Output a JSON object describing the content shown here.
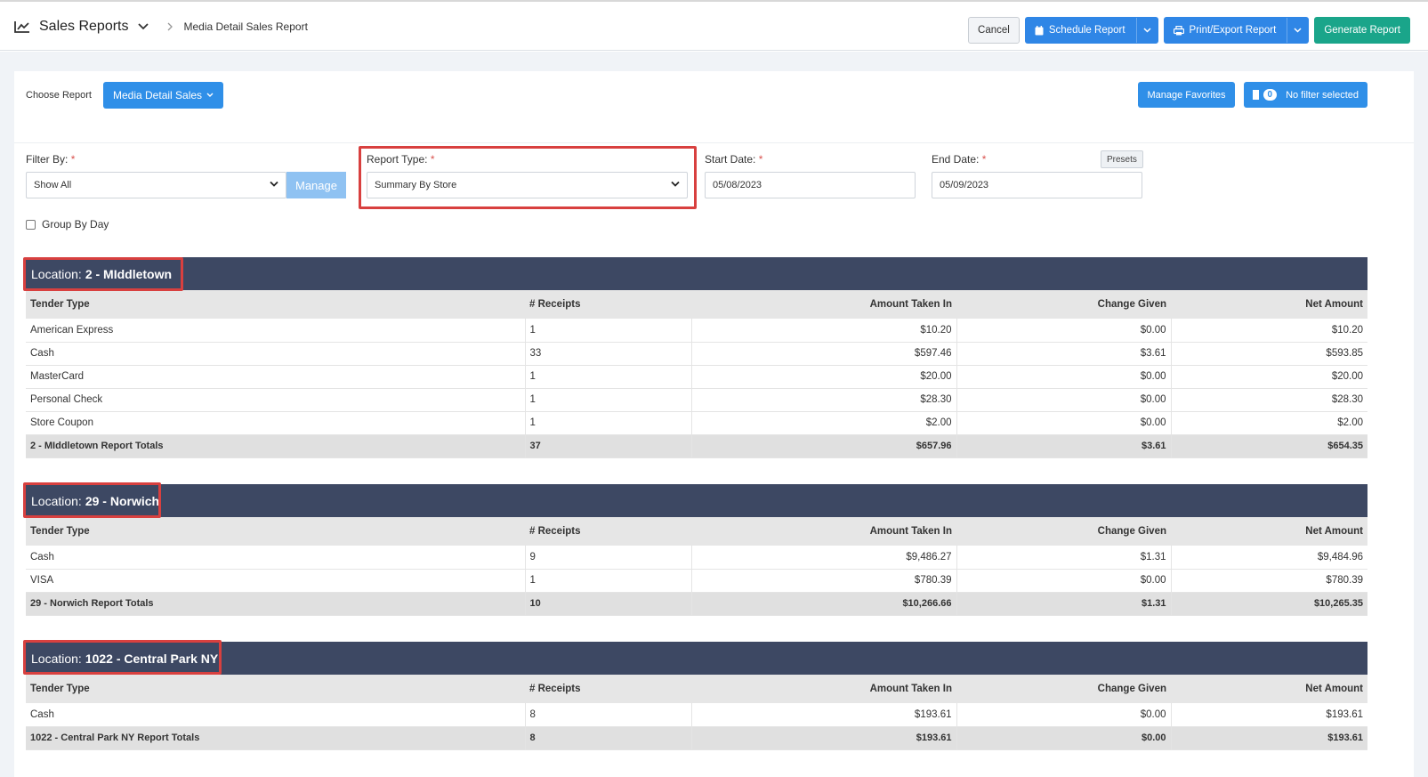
{
  "header": {
    "title": "Sales Reports",
    "breadcrumb": "Media Detail Sales Report",
    "cancel": "Cancel",
    "schedule": "Schedule Report",
    "print": "Print/Export Report",
    "generate": "Generate Report"
  },
  "toolbar": {
    "choose_label": "Choose Report",
    "report_button": "Media Detail Sales",
    "manage_favorites": "Manage Favorites",
    "filter_count": "0",
    "filter_text": "No filter selected"
  },
  "filters": {
    "filter_by_label": "Filter By:",
    "filter_by_value": "Show All",
    "manage": "Manage",
    "report_type_label": "Report Type:",
    "report_type_value": "Summary By Store",
    "start_label": "Start Date:",
    "start_value": "05/08/2023",
    "end_label": "End Date:",
    "end_value": "05/09/2023",
    "presets": "Presets",
    "group_by_day": "Group By Day",
    "required_mark": "*"
  },
  "columns": [
    "Tender Type",
    "# Receipts",
    "Amount Taken In",
    "Change Given",
    "Net Amount"
  ],
  "locations": [
    {
      "prefix": "Location:",
      "name": "2 - MIddletown",
      "rows": [
        [
          "American Express",
          "1",
          "$10.20",
          "$0.00",
          "$10.20"
        ],
        [
          "Cash",
          "33",
          "$597.46",
          "$3.61",
          "$593.85"
        ],
        [
          "MasterCard",
          "1",
          "$20.00",
          "$0.00",
          "$20.00"
        ],
        [
          "Personal Check",
          "1",
          "$28.30",
          "$0.00",
          "$28.30"
        ],
        [
          "Store Coupon",
          "1",
          "$2.00",
          "$0.00",
          "$2.00"
        ]
      ],
      "totals": [
        "2 - MIddletown Report Totals",
        "37",
        "$657.96",
        "$3.61",
        "$654.35"
      ]
    },
    {
      "prefix": "Location:",
      "name": "29 - Norwich",
      "rows": [
        [
          "Cash",
          "9",
          "$9,486.27",
          "$1.31",
          "$9,484.96"
        ],
        [
          "VISA",
          "1",
          "$780.39",
          "$0.00",
          "$780.39"
        ]
      ],
      "totals": [
        "29 - Norwich Report Totals",
        "10",
        "$10,266.66",
        "$1.31",
        "$10,265.35"
      ]
    },
    {
      "prefix": "Location:",
      "name": "1022 - Central Park NY",
      "rows": [
        [
          "Cash",
          "8",
          "$193.61",
          "$0.00",
          "$193.61"
        ]
      ],
      "totals": [
        "1022 - Central Park NY Report Totals",
        "8",
        "$193.61",
        "$0.00",
        "$193.61"
      ]
    }
  ],
  "colors": {
    "primary": "#2f8fe8",
    "success": "#1aa58a",
    "location_header": "#3d4863",
    "highlight": "#d8403f"
  }
}
